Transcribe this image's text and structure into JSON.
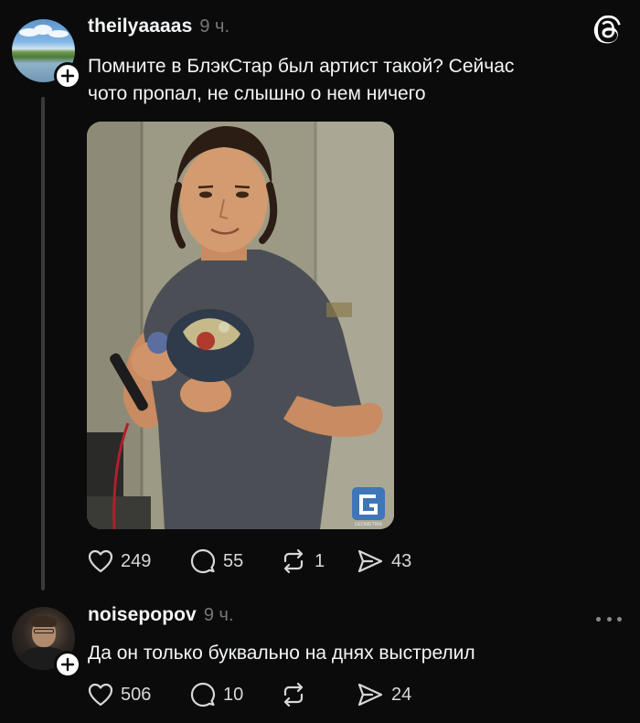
{
  "app": {
    "logo": "threads-icon"
  },
  "post": {
    "username": "theilyaaaas",
    "time": "9 ч.",
    "text_line1": "Помните в БлэкСтар был артист такой? Сейчас",
    "text_line2": "чото пропал, не слышно о нем ничего",
    "image": {
      "description": "photo",
      "watermark": "GEOMETRIA"
    },
    "likes": "249",
    "replies": "55",
    "reposts": "1",
    "shares": "43"
  },
  "reply": {
    "username": "noisepopov",
    "time": "9 ч.",
    "text": "Да он только буквально на днях выстрелил",
    "likes": "506",
    "replies": "10",
    "shares": "24"
  },
  "colors": {
    "background": "#0b0b0b",
    "text": "#f3f5f7",
    "muted": "#777777",
    "thread_line": "#3a3a3a"
  }
}
